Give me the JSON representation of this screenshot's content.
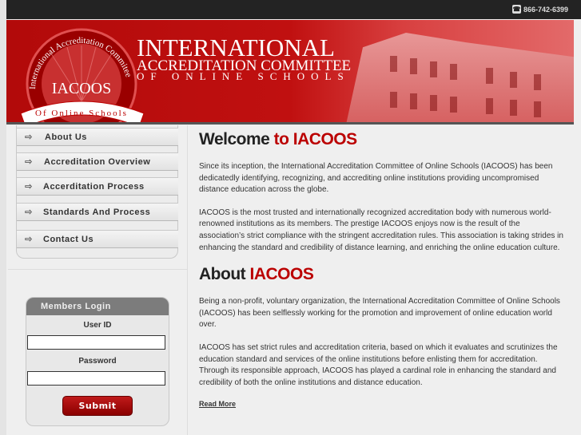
{
  "topbar": {
    "phone": "866-742-6399",
    "phone_icon": "phone-icon"
  },
  "banner": {
    "line1": "INTERNATIONAL",
    "line2": "ACCREDITATION COMMITTEE",
    "line3": "OF ONLINE SCHOOLS",
    "logo_text": "IACOOS",
    "logo_arc": "International Accreditation Commitee",
    "logo_ribbon": "Of Online Schools"
  },
  "nav": [
    {
      "label": "About Us"
    },
    {
      "label": "Accreditation Overview"
    },
    {
      "label": "Accerditation Process"
    },
    {
      "label": "Standards And Process"
    },
    {
      "label": "Contact Us"
    }
  ],
  "login": {
    "title": "Members Login",
    "user_label": "User ID",
    "user_value": "",
    "pass_label": "Password",
    "pass_value": "",
    "submit": "Submit"
  },
  "welcome": {
    "title_a": "Welcome ",
    "title_b": "to IACOOS",
    "p1": "Since its inception, the International Accreditation Committee of Online Schools (IACOOS) has been dedicatedly identifying, recognizing, and accrediting online institutions providing uncompromised distance education across the globe.",
    "p2": "IACOOS is the most trusted and internationally recognized accreditation body with numerous world-renowned institutions as its members. The prestige IACOOS enjoys now is the result of the association’s strict compliance with the stringent accreditation rules. This association is taking strides in enhancing the standard and credibility of distance learning, and enriching the online education culture."
  },
  "about": {
    "title_a": "About ",
    "title_b": "IACOOS",
    "p1": "Being a non-profit, voluntary organization, the International Accreditation Committee of Online Schools (IACOOS) has been selflessly working for the promotion and improvement of online education world over.",
    "p2": "IACOOS has set strict rules and accreditation criteria, based on which it evaluates and scrutinizes the education standard and services of the online institutions before enlisting them for accreditation. Through its responsible approach, IACOOS has played a cardinal role in enhancing the standard and credibility of both the online institutions and distance education.",
    "read_more": "Read More"
  }
}
